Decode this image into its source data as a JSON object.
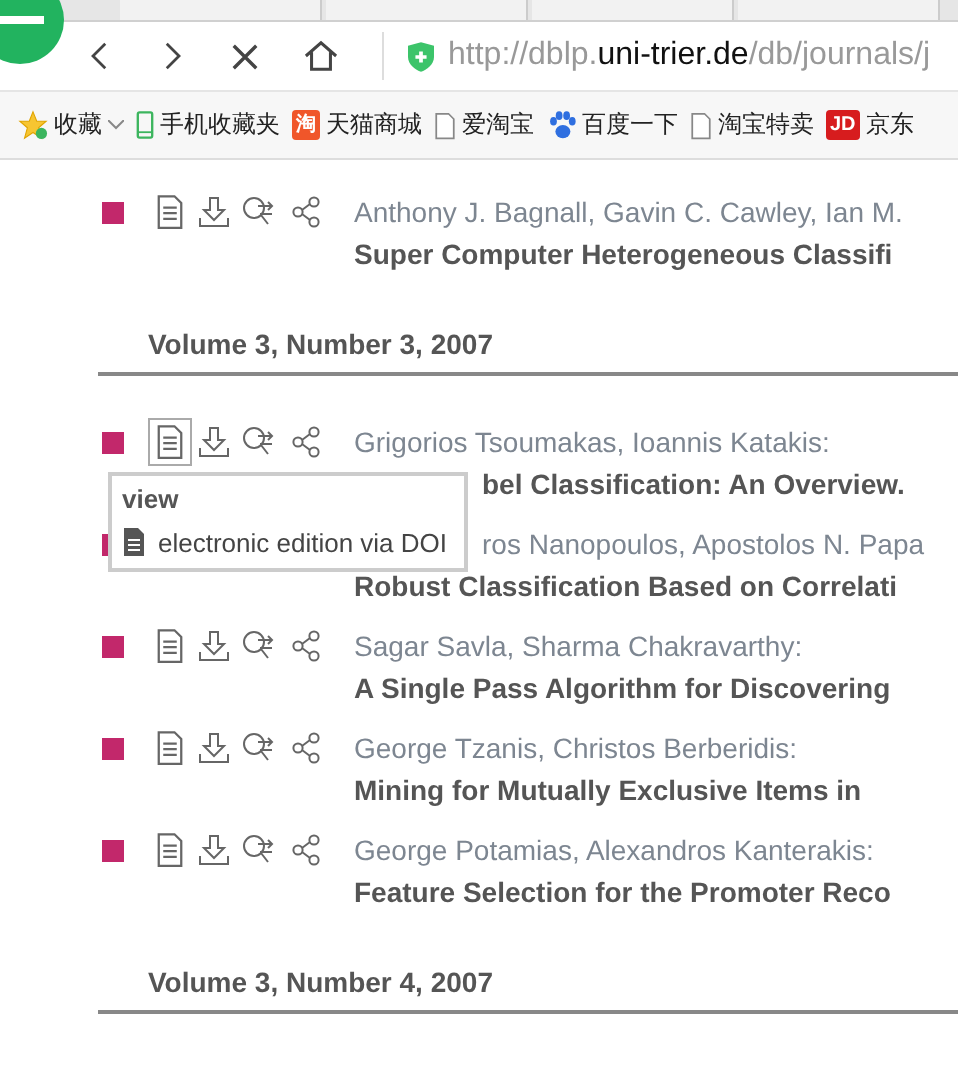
{
  "address_bar": {
    "prefix": "http://dblp.",
    "domain": "uni-trier.de",
    "path": "/db/journals/j"
  },
  "bookmarks": [
    {
      "kind": "star",
      "label": "收藏",
      "dropdown": true
    },
    {
      "kind": "phone",
      "label": "手机收藏夹",
      "dropdown": false
    },
    {
      "kind": "tmall",
      "label": "天猫商城",
      "badge": "淘",
      "dropdown": false
    },
    {
      "kind": "page",
      "label": "爱淘宝",
      "dropdown": false
    },
    {
      "kind": "paw",
      "label": "百度一下",
      "dropdown": false
    },
    {
      "kind": "page",
      "label": "淘宝特卖",
      "dropdown": false
    },
    {
      "kind": "jd",
      "label": "京东",
      "badge": "JD",
      "dropdown": false
    }
  ],
  "content": [
    {
      "kind": "entry",
      "authors": "Anthony J. Bagnall, Gavin C. Cawley, Ian M.",
      "title": "Super Computer Heterogeneous Classifi",
      "icons_visible": true,
      "hovered": false,
      "authors_covered": false,
      "title_covered": false
    },
    {
      "kind": "heading",
      "text": "Volume 3, Number 3, 2007"
    },
    {
      "kind": "entry",
      "authors": "Grigorios Tsoumakas, Ioannis Katakis:",
      "title": "bel Classification: An Overview.",
      "icons_visible": true,
      "hovered": true,
      "authors_covered": false,
      "title_covered": true,
      "tooltip": {
        "title": "view",
        "item": "electronic edition via DOI"
      }
    },
    {
      "kind": "entry",
      "authors": "ros Nanopoulos, Apostolos N. Papa",
      "title": "Robust Classification Based on Correlati",
      "icons_visible": false,
      "authors_covered": true,
      "title_covered": false
    },
    {
      "kind": "entry",
      "authors": "Sagar Savla, Sharma Chakravarthy:",
      "title": "A Single Pass Algorithm for Discovering",
      "icons_visible": true,
      "hovered": false,
      "authors_covered": false,
      "title_covered": false
    },
    {
      "kind": "entry",
      "authors": "George Tzanis, Christos Berberidis:",
      "title": "Mining for Mutually Exclusive Items in",
      "icons_visible": true,
      "hovered": false,
      "authors_covered": false,
      "title_covered": false
    },
    {
      "kind": "entry",
      "authors": "George Potamias, Alexandros Kanterakis:",
      "title": "Feature Selection for the Promoter Reco",
      "icons_visible": true,
      "hovered": false,
      "authors_covered": false,
      "title_covered": false
    },
    {
      "kind": "heading",
      "text": "Volume 3, Number 4, 2007"
    }
  ]
}
